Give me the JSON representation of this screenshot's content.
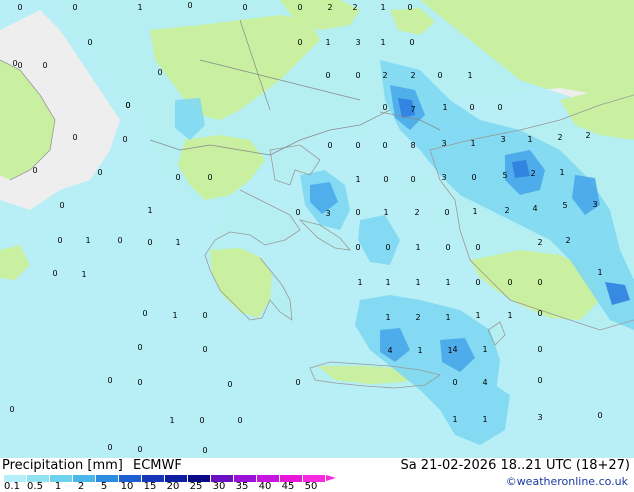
{
  "title": {
    "variable": "Precipitation [mm]",
    "model": "ECMWF"
  },
  "valid_time": "Sa 21-02-2026 18..21 UTC (18+27)",
  "credit": "©weatheronline.co.uk",
  "legend": {
    "ticks": [
      "0.1",
      "0.5",
      "1",
      "2",
      "5",
      "10",
      "15",
      "20",
      "25",
      "30",
      "35",
      "40",
      "45",
      "50"
    ],
    "colors": [
      "#b4eef6",
      "#93e2f2",
      "#6ed2ee",
      "#4ab7ea",
      "#2c8ce0",
      "#1d5fd0",
      "#1537b8",
      "#0f1ea0",
      "#0a0a86",
      "#6a10c0",
      "#9a12d8",
      "#c814e0",
      "#e818d8",
      "#f82ae0"
    ]
  },
  "map_colors": {
    "sea": "#eeeeee",
    "land": "#c8f0a0",
    "precip_light": "#b4eef6",
    "precip_mid": "#7fd8f2",
    "precip_heavy": "#4aa8ea",
    "precip_core": "#2f7fe0",
    "coast": "#9a9a9a",
    "border": "#888888"
  },
  "grid_values": [
    "0",
    "0",
    "1",
    "0",
    "0",
    "0",
    "2",
    "2",
    "1",
    "0",
    "0",
    "0",
    "0",
    "0",
    "1",
    "3",
    "1",
    "0",
    "0",
    "0",
    "0",
    "0",
    "2",
    "2",
    "0",
    "1",
    "0",
    "0",
    "0",
    "7",
    "1",
    "0",
    "0",
    "0",
    "0",
    "0",
    "0",
    "0",
    "8",
    "3",
    "1",
    "3",
    "1",
    "2",
    "2",
    "0",
    "0",
    "0",
    "0",
    "1",
    "0",
    "0",
    "3",
    "0",
    "5",
    "2",
    "1",
    "1",
    "0",
    "0",
    "3",
    "0",
    "1",
    "2",
    "0",
    "1",
    "2",
    "4",
    "5",
    "3",
    "0",
    "1",
    "0",
    "0",
    "1",
    "0",
    "0",
    "1",
    "0",
    "0",
    "2",
    "2",
    "0",
    "1",
    "1",
    "1",
    "1",
    "1",
    "0",
    "0",
    "0",
    "1",
    "0",
    "1",
    "0",
    "1",
    "2",
    "1",
    "1",
    "1",
    "0",
    "0",
    "0",
    "4",
    "1",
    "1",
    "4",
    "1",
    "0",
    "0",
    "0",
    "0",
    "0",
    "0",
    "4",
    "0",
    "0",
    "1",
    "0",
    "0",
    "1",
    "1",
    "3",
    "0",
    "0",
    "0",
    "0"
  ]
}
